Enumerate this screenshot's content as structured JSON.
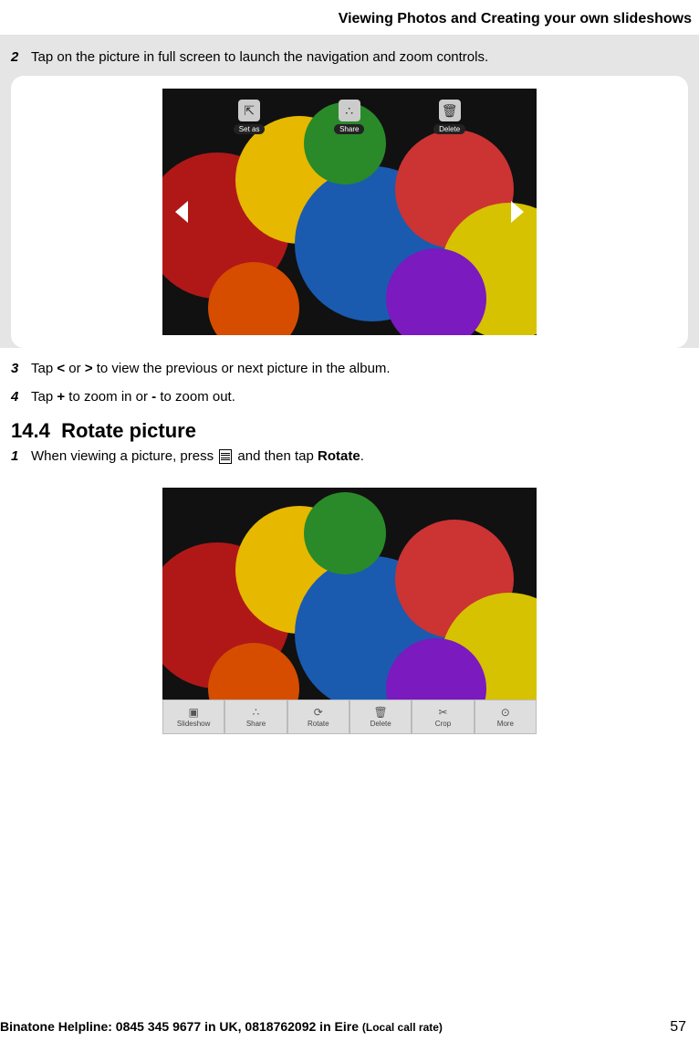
{
  "header": "Viewing Photos and Creating your own slideshows",
  "steps_top": {
    "s2": {
      "num": "2",
      "text_before": "Tap on the picture in full screen to launch the navigation and zoom controls."
    }
  },
  "screen1": {
    "controls": {
      "setas": {
        "label": "Set as"
      },
      "share": {
        "label": "Share"
      },
      "delete": {
        "label": "Delete"
      }
    }
  },
  "steps_mid": {
    "s3": {
      "num": "3",
      "pre": "Tap ",
      "b1": "<",
      "mid": " or ",
      "b2": ">",
      "post": " to view the previous or next picture in the album."
    },
    "s4": {
      "num": "4",
      "pre": "Tap ",
      "b1": "+",
      "mid": " to zoom in or ",
      "b2": "-",
      "post": "  to zoom out."
    }
  },
  "section": {
    "number": "14.4",
    "title": "Rotate picture"
  },
  "steps_rotate": {
    "s1": {
      "num": "1",
      "pre": "When viewing a picture, press ",
      "post": " and then tap ",
      "b": "Rotate",
      "end": "."
    }
  },
  "screen2": {
    "bottom_bar": {
      "slideshow": "Slideshow",
      "share": "Share",
      "rotate": "Rotate",
      "delete": "Delete",
      "crop": "Crop",
      "more": "More"
    }
  },
  "footer": {
    "helpline_bold": "Binatone Helpline: 0845 345 9677 in UK, 0818762092 in Eire ",
    "rate": "(Local call rate)",
    "page": "57"
  }
}
